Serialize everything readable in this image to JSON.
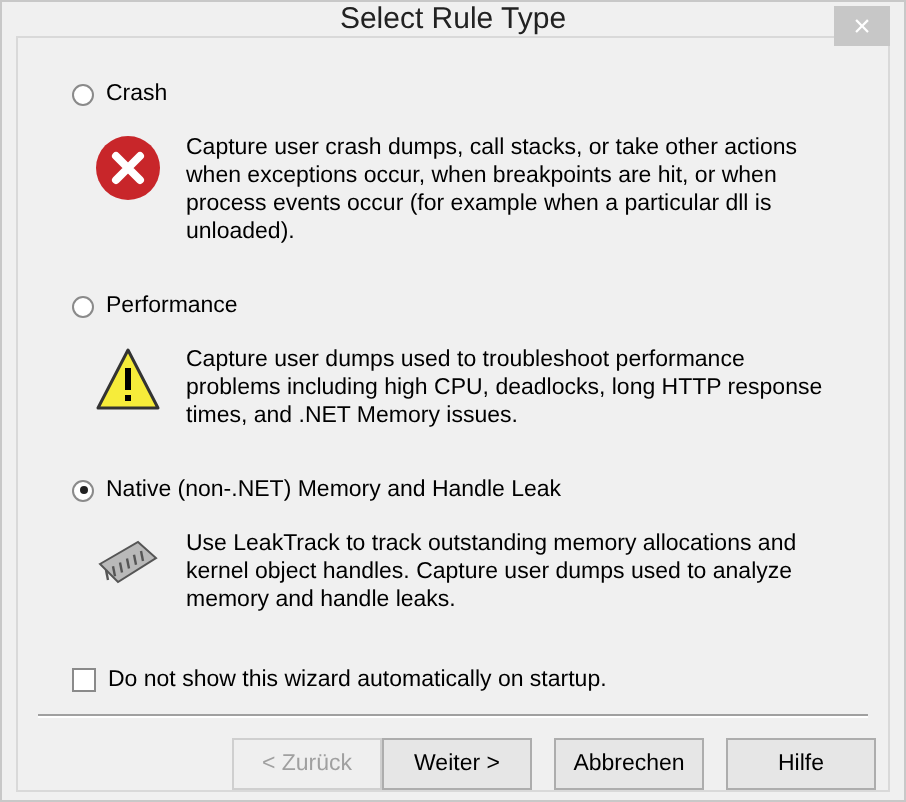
{
  "window": {
    "title": "Select Rule Type",
    "close": "×"
  },
  "options": [
    {
      "label": "Crash",
      "selected": false,
      "kind": "error",
      "description": "Capture user crash dumps, call stacks, or take other actions when exceptions occur, when breakpoints are hit, or when process events occur (for example when a particular dll is unloaded)."
    },
    {
      "label": "Performance",
      "selected": false,
      "kind": "warning",
      "description": "Capture user dumps used to troubleshoot performance problems including high CPU, deadlocks, long HTTP response times, and .NET Memory issues."
    },
    {
      "label": "Native (non-.NET) Memory and Handle Leak",
      "selected": true,
      "kind": "chip",
      "description": "Use LeakTrack to track outstanding memory allocations and kernel object handles. Capture user dumps used to analyze memory and handle leaks."
    }
  ],
  "checkbox": {
    "label": "Do not show this wizard automatically on startup.",
    "checked": false
  },
  "buttons": [
    {
      "label": "< Zurück",
      "disabled": true
    },
    {
      "label": "Weiter >",
      "disabled": false
    },
    {
      "label": "Abbrechen",
      "disabled": false
    },
    {
      "label": "Hilfe",
      "disabled": false
    }
  ]
}
